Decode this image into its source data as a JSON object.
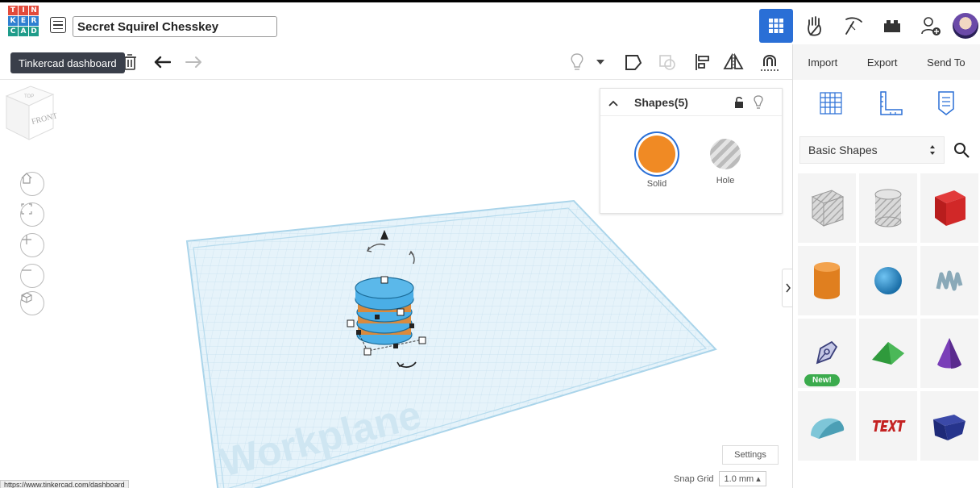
{
  "app": {
    "project_title": "Secret Squirel Chesskey"
  },
  "toolbar": {
    "tooltip": "Tinkercad dashboard"
  },
  "actions": {
    "import": "Import",
    "export": "Export",
    "send_to": "Send To"
  },
  "shapes_panel": {
    "title": "Shapes(5)",
    "solid": "Solid",
    "hole": "Hole",
    "solid_color": "#f08a24"
  },
  "viewcube": {
    "top": "TOP",
    "front": "FRONT"
  },
  "workplane": {
    "label": "Workplane"
  },
  "bottom": {
    "settings": "Settings",
    "snap_label": "Snap Grid",
    "snap_value": "1.0 mm"
  },
  "status": {
    "url": "https://www.tinkercad.com/dashboard"
  },
  "sidebar": {
    "category": "Basic Shapes",
    "new_badge": "New!"
  },
  "colors": {
    "accent": "#2a6fd6",
    "selection": "#4aaee6"
  }
}
